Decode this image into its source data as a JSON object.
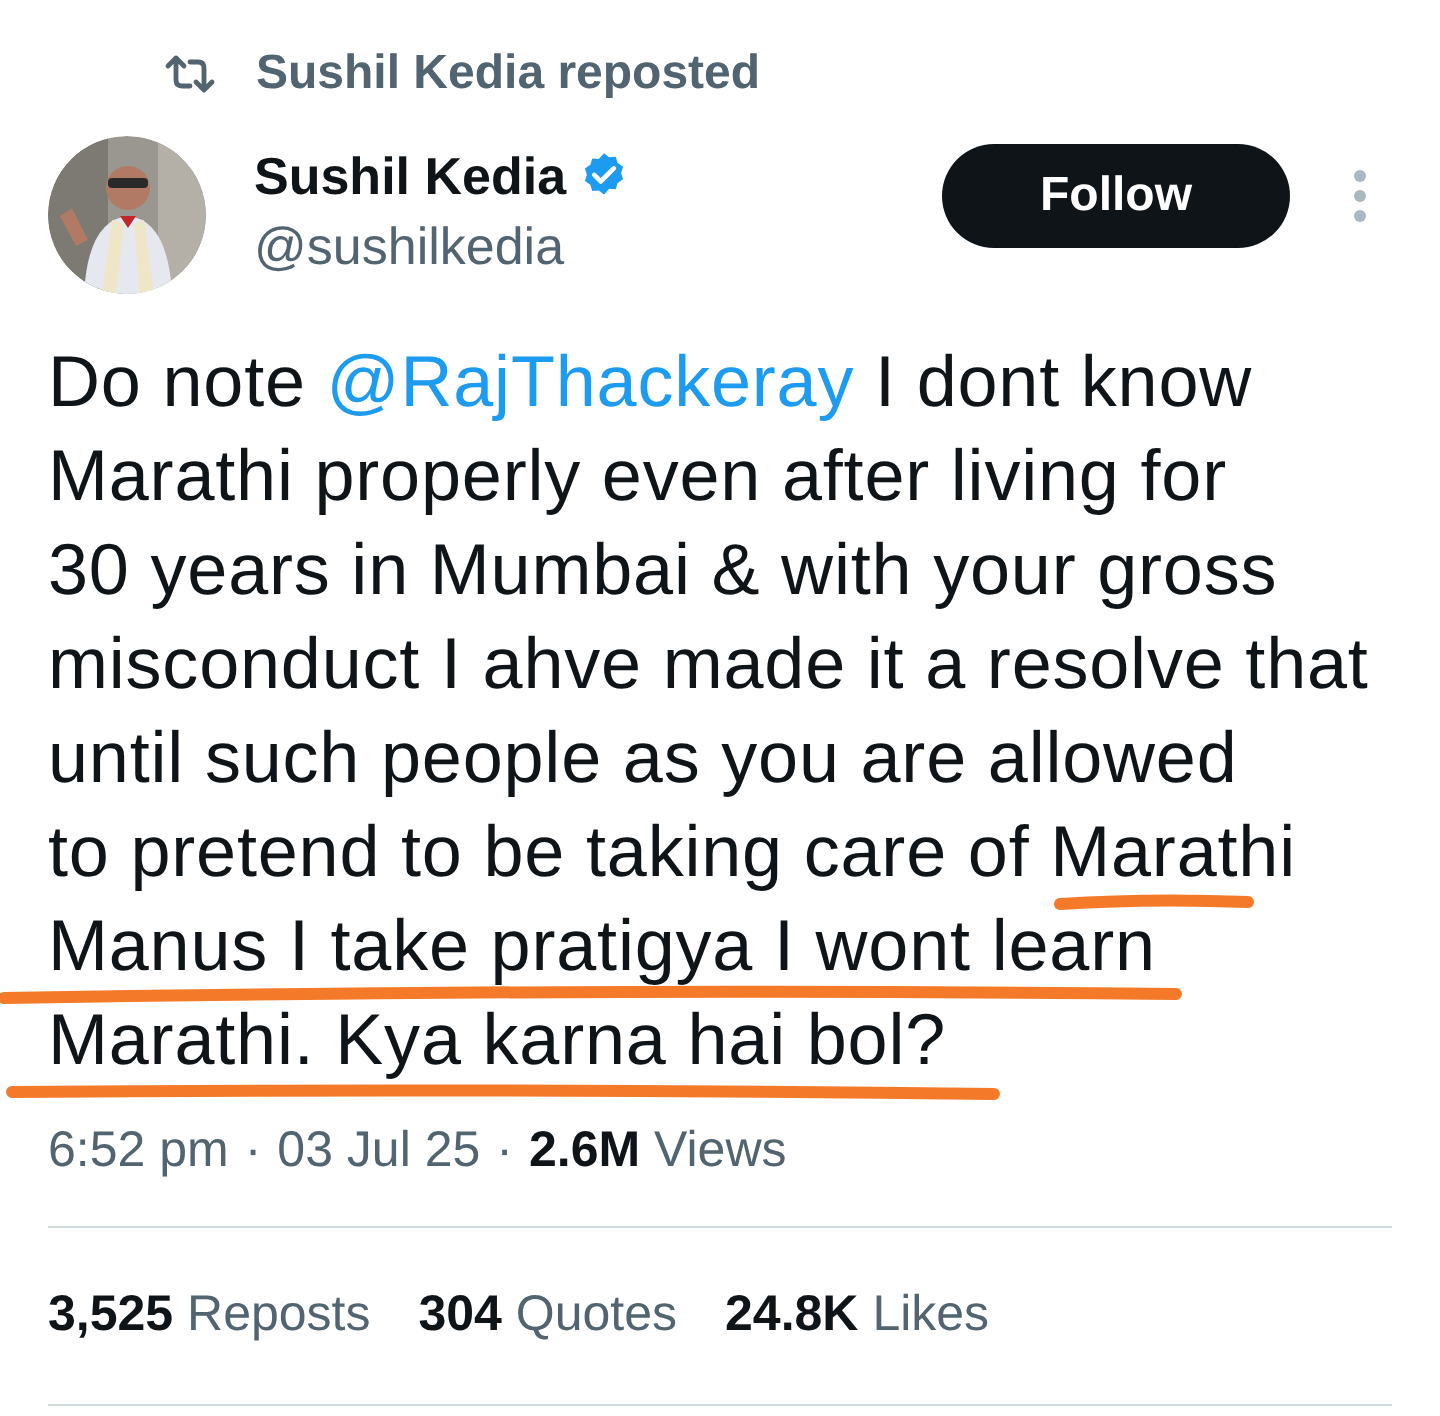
{
  "repost_banner": {
    "text": "Sushil Kedia reposted"
  },
  "author": {
    "name": "Sushil Kedia",
    "verified": true,
    "handle": "@sushilkedia"
  },
  "follow_button": {
    "label": "Follow"
  },
  "body": {
    "before": "Do note ",
    "mention": "@RajThackeray",
    "lines": [
      " I dont know",
      "Marathi properly even after living for",
      "30 years in Mumbai & with your gross",
      "misconduct I ahve made it a resolve that",
      "until such people as you are allowed",
      "to pretend to be taking care of Marathi",
      "Manus I take pratigya I wont learn",
      "Marathi. Kya karna hai bol?"
    ]
  },
  "annotations": [
    {
      "kind": "underline",
      "color": "#f47a2a"
    },
    {
      "kind": "underline",
      "color": "#f47a2a"
    },
    {
      "kind": "underline",
      "color": "#f47a2a"
    }
  ],
  "meta": {
    "time": "6:52 pm",
    "separator_1": "·",
    "date": "03 Jul 25",
    "separator_2": "·",
    "views_count": "2.6M",
    "views_label": "Views"
  },
  "stats": [
    {
      "count": "3,525",
      "label": "Reposts"
    },
    {
      "count": "304",
      "label": "Quotes"
    },
    {
      "count": "24.8K",
      "label": "Likes"
    }
  ]
}
